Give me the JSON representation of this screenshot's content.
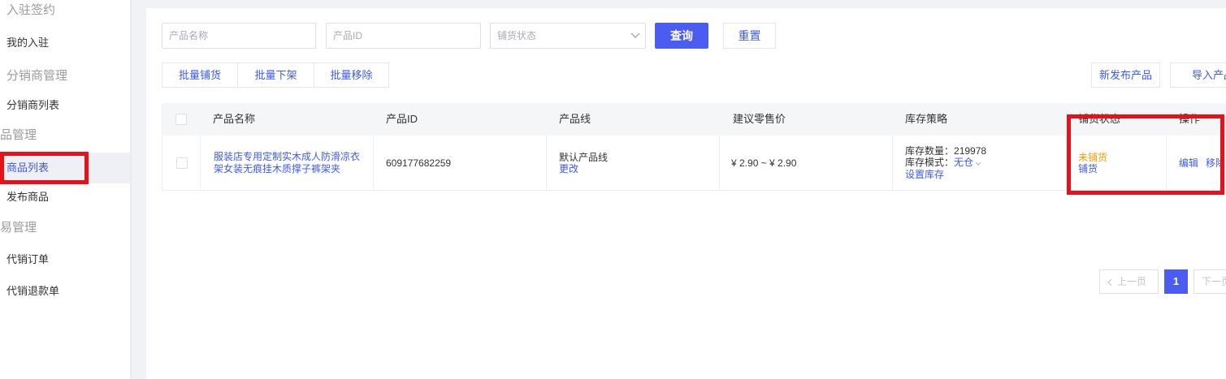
{
  "theme": {
    "accent": "#4b5cf0",
    "link": "#3d5af1",
    "warning": "#ff9900",
    "highlight": "#e8101a",
    "active_bg": "#eef0f5",
    "page_bg": "#f0f2f5"
  },
  "icons": {
    "select_chevron": "chevron-down-icon",
    "stock_mode_chevron": "chevron-down-icon",
    "prev_page": "chevron-left-icon"
  },
  "sidebar": {
    "groups": [
      {
        "title": "入驻签约",
        "items": [
          {
            "label": "我的入驻"
          }
        ]
      },
      {
        "title": "分销商管理",
        "items": [
          {
            "label": "分销商列表"
          }
        ]
      },
      {
        "title": "品管理",
        "items": [
          {
            "label": "商品列表",
            "active": true
          },
          {
            "label": "发布商品"
          }
        ]
      },
      {
        "title": "易管理",
        "items": [
          {
            "label": "代销订单"
          },
          {
            "label": "代销退款单"
          }
        ]
      }
    ]
  },
  "filters": {
    "product_name_placeholder": "产品名称",
    "product_id_placeholder": "产品ID",
    "status_placeholder": "铺货状态",
    "query_label": "查询",
    "reset_label": "重置"
  },
  "batch_actions": [
    "批量铺货",
    "批量下架",
    "批量移除"
  ],
  "top_actions": {
    "new_product": "新发布产品",
    "import_product": "导入产品"
  },
  "table": {
    "select_all": false,
    "columns": [
      "产品名称",
      "产品ID",
      "产品线",
      "建议零售价",
      "库存策略",
      "铺货状态",
      "操作"
    ],
    "rows": [
      {
        "selected": false,
        "name": "服装店专用定制实木成人防滑凉衣架女装无痕挂木质撑子裤架夹",
        "id": "609177682259",
        "product_line": "默认产品线",
        "product_line_action": "更改",
        "price": "¥ 2.90 ~ ¥ 2.90",
        "stock_qty_label": "库存数量：",
        "stock_qty": "219978",
        "stock_mode_label": "库存模式：",
        "stock_mode": "无仓",
        "stock_action": "设置库存",
        "status": "未铺货",
        "status_action": "铺货",
        "actions": [
          "编辑",
          "移除"
        ]
      }
    ]
  },
  "pagination": {
    "prev": "上一页",
    "current": "1",
    "next": "下一页"
  }
}
